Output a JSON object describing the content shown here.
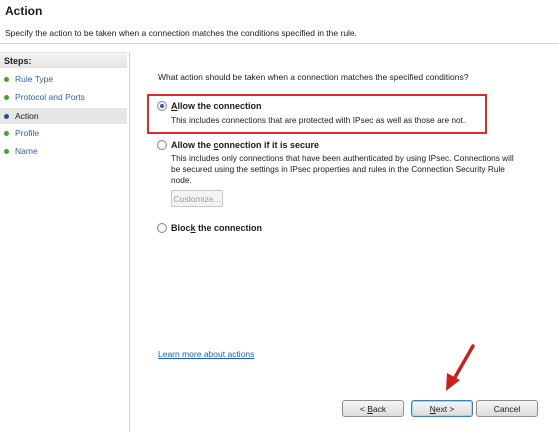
{
  "header": {
    "title": "Action",
    "subtitle": "Specify the action to be taken when a connection matches the conditions specified in the rule."
  },
  "sidebar": {
    "steps_label": "Steps:",
    "items": [
      {
        "label": "Rule Type",
        "current": false
      },
      {
        "label": "Protocol and Ports",
        "current": false
      },
      {
        "label": "Action",
        "current": true
      },
      {
        "label": "Profile",
        "current": false
      },
      {
        "label": "Name",
        "current": false
      }
    ]
  },
  "main": {
    "question": "What action should be taken when a connection matches the specified conditions?",
    "options": [
      {
        "pre": "",
        "mnemonic": "A",
        "post": "llow the connection",
        "description": "This includes connections that are protected with IPsec as well as those are not.",
        "checked": true
      },
      {
        "pre": "Allow the ",
        "mnemonic": "c",
        "post": "onnection if it is secure",
        "description": "This includes only connections that have been authenticated by using IPsec.  Connections will be secured using the settings in IPsec properties and rules in the Connection Security Rule node.",
        "checked": false
      },
      {
        "pre": "Bloc",
        "mnemonic": "k",
        "post": " the connection",
        "description": "",
        "checked": false
      }
    ],
    "customize_label": "Customize...",
    "learn_more": "Learn more about actions"
  },
  "buttons": {
    "back_pre": "< ",
    "back_mnemonic": "B",
    "back_post": "ack",
    "next_mnemonic": "N",
    "next_post": "ext >",
    "cancel": "Cancel"
  },
  "colors": {
    "highlight": "#e02a2a",
    "arrow": "#c8201e",
    "link": "#1a5fc2"
  }
}
